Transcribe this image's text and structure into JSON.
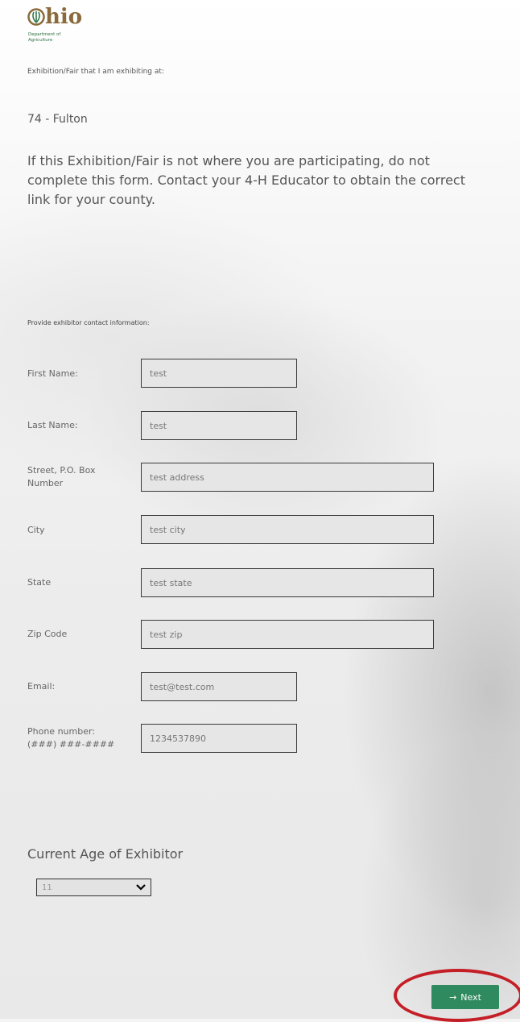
{
  "logo": {
    "word": "hio",
    "sub_line1": "Department of",
    "sub_line2": "Agriculture"
  },
  "intro_label": "Exhibition/Fair that I am exhibiting at:",
  "fair_name": "74 - Fulton",
  "notice": "If this Exhibition/Fair is not where you are participating, do not complete this form.  Contact your 4-H Educator to obtain the correct link for your county.",
  "contact_label": "Provide exhibitor contact information:",
  "fields": {
    "first_name": {
      "label": "First Name:",
      "value": "test"
    },
    "last_name": {
      "label": "Last Name:",
      "value": "test"
    },
    "street": {
      "label_line1": "Street, P.O. Box",
      "label_line2": "Number",
      "value": "test address"
    },
    "city": {
      "label": "City",
      "value": "test city"
    },
    "state": {
      "label": "State",
      "value": "test state"
    },
    "zip": {
      "label": "Zip Code",
      "value": "test zip"
    },
    "email": {
      "label": "Email:",
      "value": "test@test.com"
    },
    "phone": {
      "label_line1": "Phone number:",
      "label_line2": "(###) ###-####",
      "value": "1234537890"
    }
  },
  "age": {
    "heading": "Current Age of Exhibitor",
    "selected": "11"
  },
  "next_button": {
    "label": "Next",
    "arrow": "→"
  },
  "colors": {
    "accent": "#2f8a5f",
    "highlight": "#c41e26",
    "logo_brown": "#8a6a3a"
  }
}
